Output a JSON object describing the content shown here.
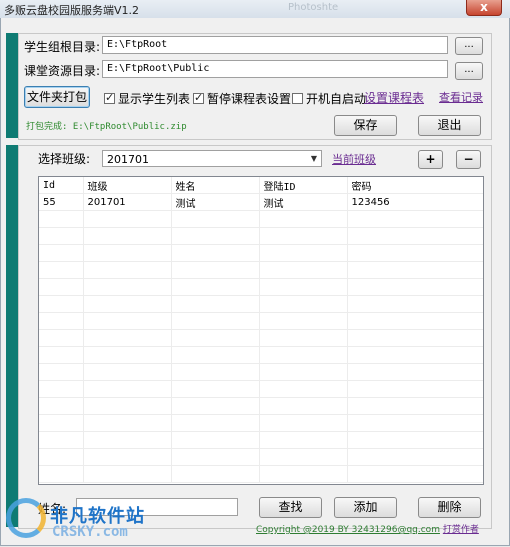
{
  "window": {
    "title": "多贩云盘校园版服务端V1.2",
    "ghost_text": "Photoshte",
    "close": "x"
  },
  "settings": {
    "student_root_label": "学生组根目录:",
    "student_root_value": "E:\\FtpRoot",
    "course_root_label": "课堂资源目录:",
    "course_root_value": "E:\\FtpRoot\\Public",
    "browse_label": "...",
    "pack_button": "文件夹打包",
    "show_students": {
      "label": "显示学生列表",
      "checked": true
    },
    "pause_schedule": {
      "label": "暂停课程表设置",
      "checked": true
    },
    "autostart": {
      "label": "开机自启动",
      "checked": false
    },
    "set_schedule_link": "设置课程表",
    "view_log_link": "查看记录",
    "pack_status": "打包完成: E:\\FtpRoot\\Public.zip",
    "save_button": "保存",
    "exit_button": "退出"
  },
  "class_panel": {
    "select_label": "选择班级:",
    "class_value": "201701",
    "current_class_link": "当前班级",
    "plus": "+",
    "minus": "−"
  },
  "table": {
    "columns": [
      "Id",
      "班级",
      "姓名",
      "登陆ID",
      "密码"
    ],
    "rows": [
      [
        "55",
        "201701",
        "测试",
        "测试",
        "123456"
      ]
    ]
  },
  "bottom": {
    "name_label": "姓名:",
    "name_value": "",
    "find_button": "查找",
    "add_button": "添加",
    "delete_button": "删除",
    "copyright": "Copyright @2019 BY 32431296@qq.com",
    "donate_link": "打赏作者"
  },
  "watermark": {
    "cn": "非凡软件站",
    "en": "CRSKY.com"
  }
}
